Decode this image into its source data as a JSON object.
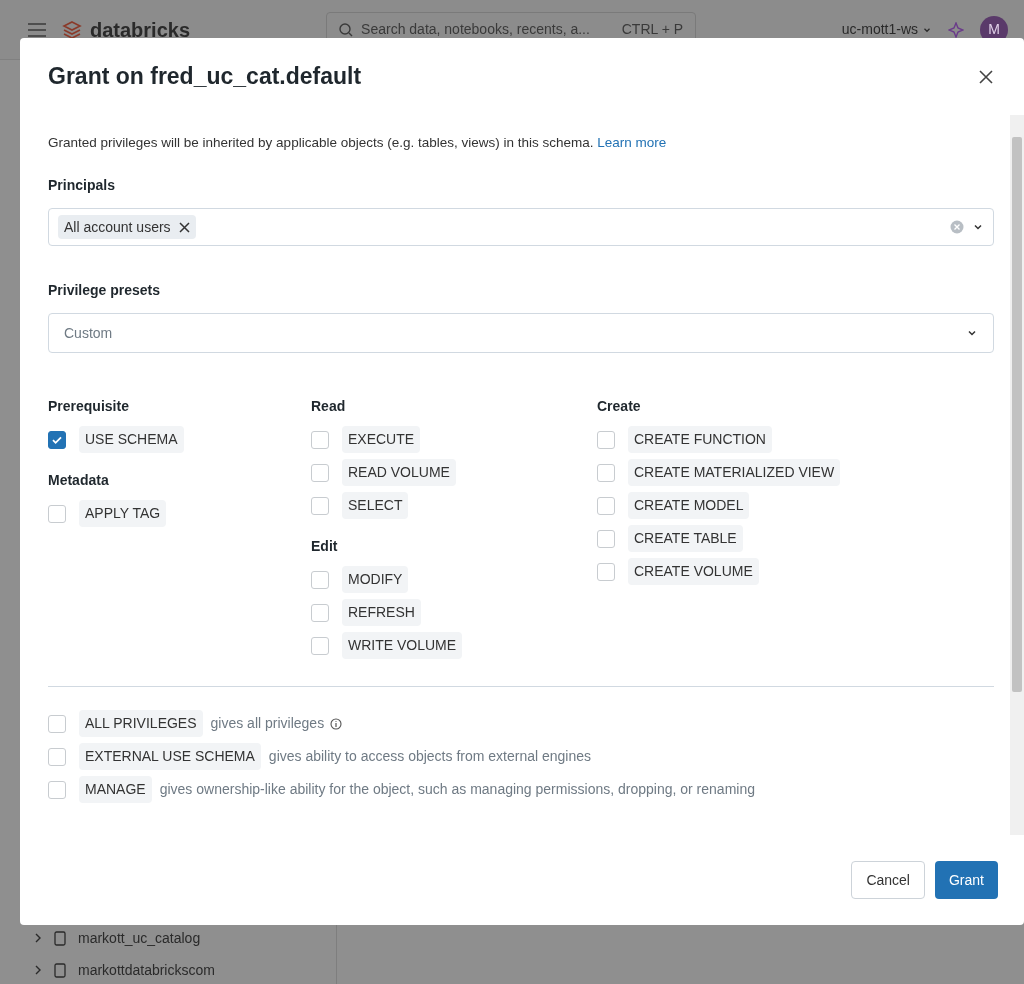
{
  "app_header": {
    "logo": "databricks",
    "search_placeholder": "Search data, notebooks, recents, a...",
    "search_shortcut": "CTRL + P",
    "workspace": "uc-mott1-ws",
    "avatar": "M"
  },
  "catalog_tree": [
    {
      "label": "markott_uc_catalog"
    },
    {
      "label": "markottdatabrickscom"
    }
  ],
  "dialog": {
    "title": "Grant on fred_uc_cat.default",
    "description": "Granted privileges will be inherited by applicable objects (e.g. tables, views) in this schema.",
    "link": "Learn more",
    "principals": {
      "label": "Principals",
      "chips": [
        "All account users"
      ]
    },
    "presets": {
      "label": "Privilege presets",
      "value": "Custom"
    },
    "columns": [
      {
        "groups": [
          {
            "title": "Prerequisite",
            "items": [
              {
                "label": "USE SCHEMA",
                "checked": true
              }
            ]
          },
          {
            "title": "Metadata",
            "items": [
              {
                "label": "APPLY TAG",
                "checked": false
              }
            ]
          }
        ]
      },
      {
        "groups": [
          {
            "title": "Read",
            "items": [
              {
                "label": "EXECUTE",
                "checked": false
              },
              {
                "label": "READ VOLUME",
                "checked": false
              },
              {
                "label": "SELECT",
                "checked": false
              }
            ]
          },
          {
            "title": "Edit",
            "items": [
              {
                "label": "MODIFY",
                "checked": false
              },
              {
                "label": "REFRESH",
                "checked": false
              },
              {
                "label": "WRITE VOLUME",
                "checked": false
              }
            ]
          }
        ]
      },
      {
        "groups": [
          {
            "title": "Create",
            "items": [
              {
                "label": "CREATE FUNCTION",
                "checked": false
              },
              {
                "label": "CREATE MATERIALIZED VIEW",
                "checked": false
              },
              {
                "label": "CREATE MODEL",
                "checked": false
              },
              {
                "label": "CREATE TABLE",
                "checked": false
              },
              {
                "label": "CREATE VOLUME",
                "checked": false
              }
            ]
          }
        ]
      }
    ],
    "special": [
      {
        "label": "ALL PRIVILEGES",
        "description": "gives all privileges",
        "checked": false,
        "info": true
      },
      {
        "label": "EXTERNAL USE SCHEMA",
        "description": "gives ability to access objects from external engines",
        "checked": false,
        "info": false
      },
      {
        "label": "MANAGE",
        "description": "gives ownership-like ability for the object, such as managing permissions, dropping, or renaming",
        "checked": false,
        "info": false
      }
    ],
    "buttons": [
      {
        "label": "Cancel",
        "kind": "secondary"
      },
      {
        "label": "Grant",
        "kind": "primary"
      }
    ]
  }
}
